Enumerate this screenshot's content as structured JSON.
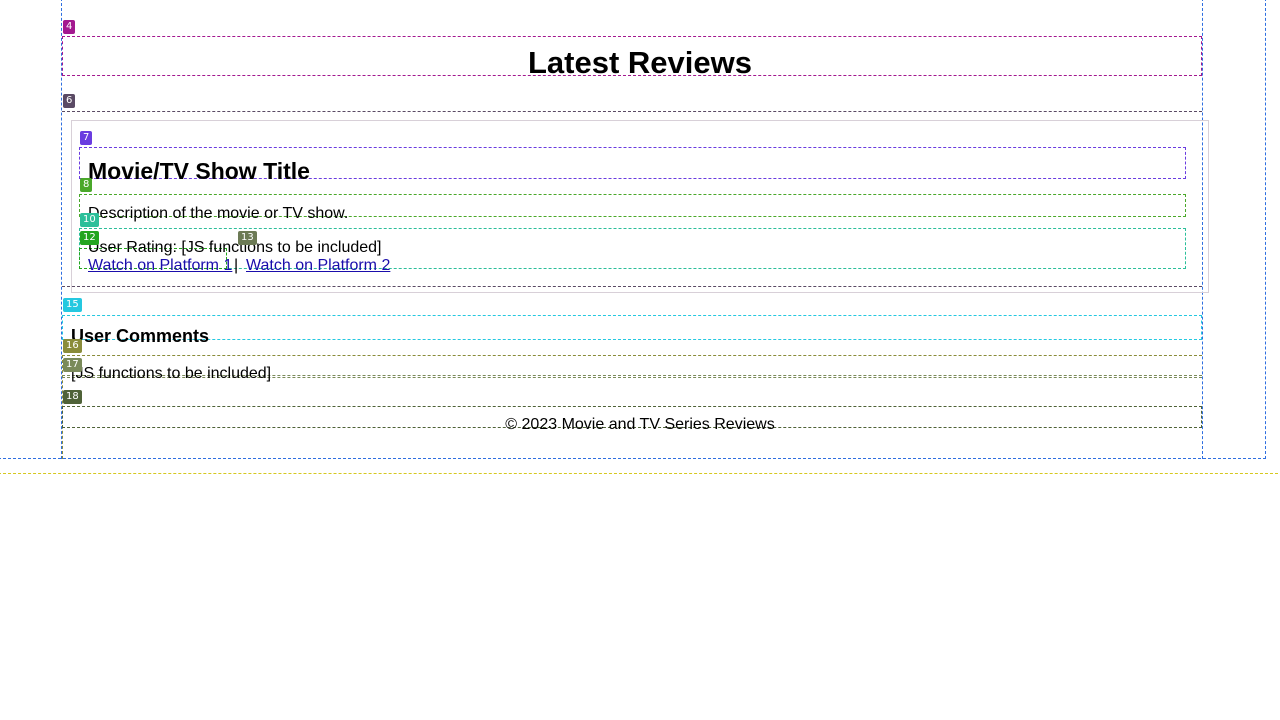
{
  "header": {
    "title": "Latest Reviews"
  },
  "review": {
    "title": "Movie/TV Show Title",
    "description": "Description of the movie or TV show.",
    "rating_label": "User Rating: [JS functions to be included]",
    "links": [
      {
        "label": "Watch on Platform 1"
      },
      {
        "label": "Watch on Platform 2"
      }
    ],
    "link_separator": "|"
  },
  "comments": {
    "heading": "User Comments",
    "placeholder": "[JS functions to be included]"
  },
  "footer": {
    "text": "© 2023 Movie and TV Series Reviews"
  },
  "overlay_labels": {
    "header": "4",
    "reviews_section": "6",
    "review_title": "7",
    "review_description": "8",
    "review_rating": "10",
    "review_link_1": "12",
    "review_link_2": "13",
    "comments_heading": "15",
    "comments_box": "16",
    "comments_placeholder": "17",
    "footer": "18"
  },
  "colors": {
    "header": "#a3188f",
    "reviews_section": "#5a4a64",
    "review_title": "#6a3ce0",
    "review_description": "#4aa82a",
    "review_rating": "#2bbf9a",
    "review_link_1": "#22a51e",
    "review_link_2": "#6c7a55",
    "comments_heading": "#25c8e0",
    "comments_box": "#8a8c3a",
    "comments_placeholder": "#7a8a5a",
    "footer": "#4f6238",
    "link": "#1a0dab"
  }
}
